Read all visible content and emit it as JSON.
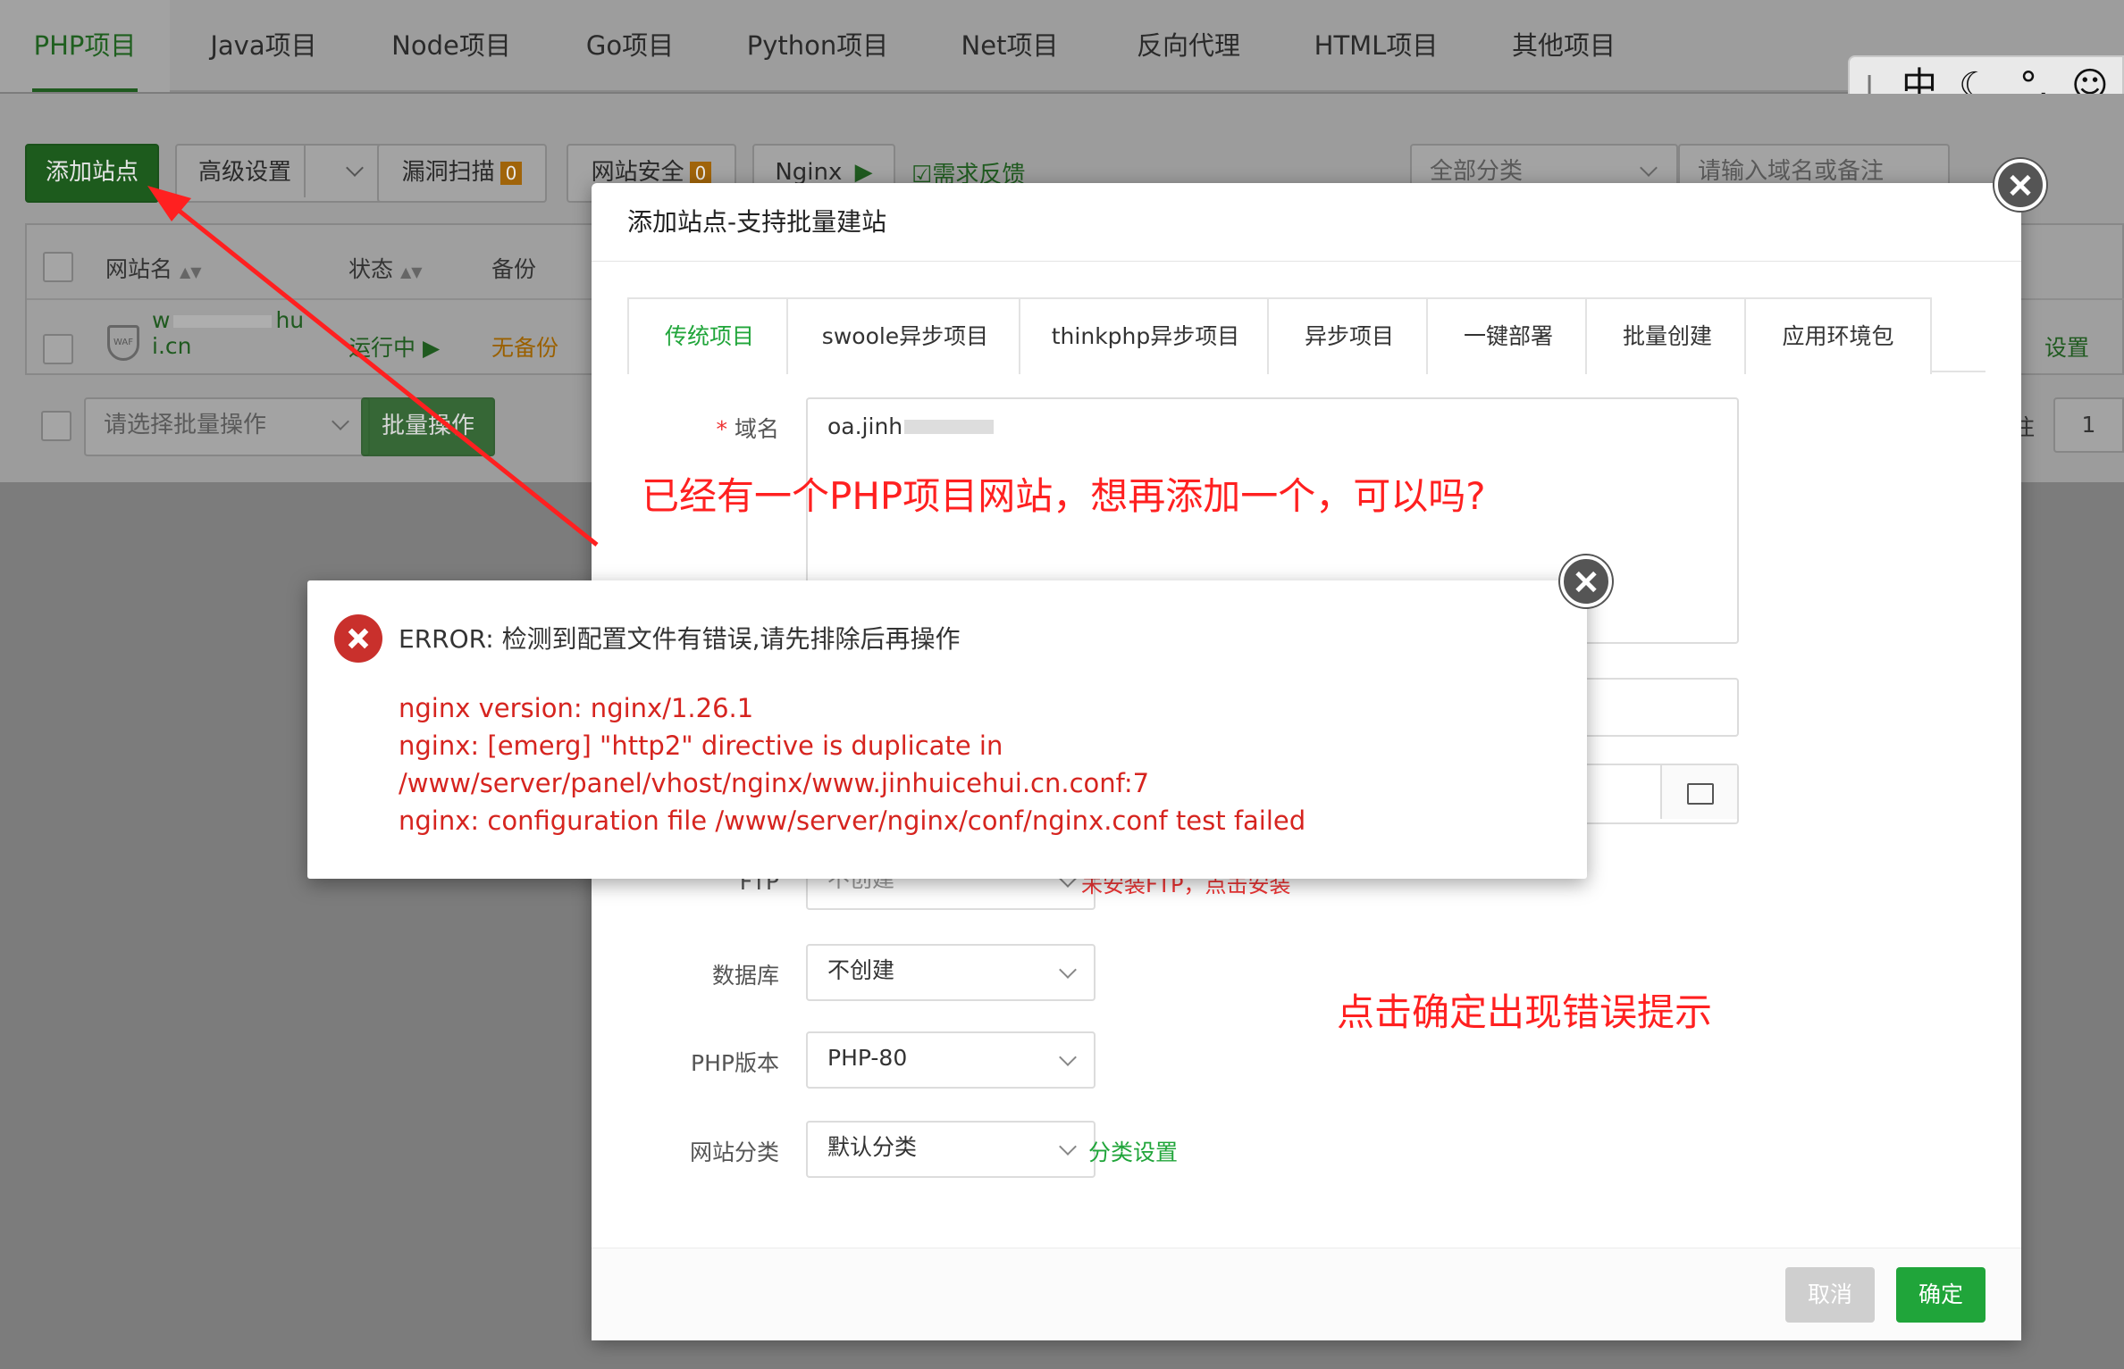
{
  "topnav": {
    "tabs": [
      "PHP项目",
      "Java项目",
      "Node项目",
      "Go项目",
      "Python项目",
      "Net项目",
      "反向代理",
      "HTML项目",
      "其他项目"
    ]
  },
  "toolbar": {
    "add_site": "添加站点",
    "advanced": "高级设置",
    "vuln_scan": "漏洞扫描",
    "vuln_count": "0",
    "site_security": "网站安全",
    "security_count": "0",
    "nginx": "Nginx",
    "feedback": "需求反馈",
    "category_select": "全部分类",
    "search_placeholder": "请输入域名或备注"
  },
  "table": {
    "headers": [
      "网站名",
      "状态",
      "备份"
    ],
    "row": {
      "name_part1": "w",
      "name_part2": "hu",
      "name_part3": "i.cn",
      "status": "运行中",
      "backup": "无备份",
      "settings": "设置"
    },
    "batch_placeholder": "请选择批量操作",
    "batch_button": "批量操作",
    "page_suffix": "注",
    "page_number": "1"
  },
  "ime": {
    "mode": "中",
    "punct": "°,"
  },
  "dialog": {
    "title": "添加站点-支持批量建站",
    "tabs": [
      "传统项目",
      "swoole异步项目",
      "thinkphp异步项目",
      "异步项目",
      "一键部署",
      "批量创建",
      "应用环境包"
    ],
    "domain_label": "域名",
    "domain_value": "oa.jinh",
    "ftp_label": "FTP",
    "ftp_value": "不创建",
    "ftp_hint": "未安装FTP，点击安装",
    "db_label": "数据库",
    "db_value": "不创建",
    "php_label": "PHP版本",
    "php_value": "PHP-80",
    "category_label": "网站分类",
    "category_value": "默认分类",
    "category_settings": "分类设置",
    "cancel": "取消",
    "confirm": "确定"
  },
  "error": {
    "title": "ERROR: 检测到配置文件有错误,请先排除后再操作",
    "lines": [
      "nginx version: nginx/1.26.1",
      "nginx: [emerg] \"http2\" directive is duplicate in",
      "/www/server/panel/vhost/nginx/www.jinhuicehui.cn.conf:7",
      "nginx: configuration file /www/server/nginx/conf/nginx.conf test failed"
    ]
  },
  "annotations": {
    "question": "已经有一个PHP项目网站，想再添加一个，可以吗?",
    "note": "点击确定出现错误提示"
  },
  "colors": {
    "green": "#20a53a",
    "error_red": "#d6241f",
    "annotation_red": "#ff2020"
  }
}
